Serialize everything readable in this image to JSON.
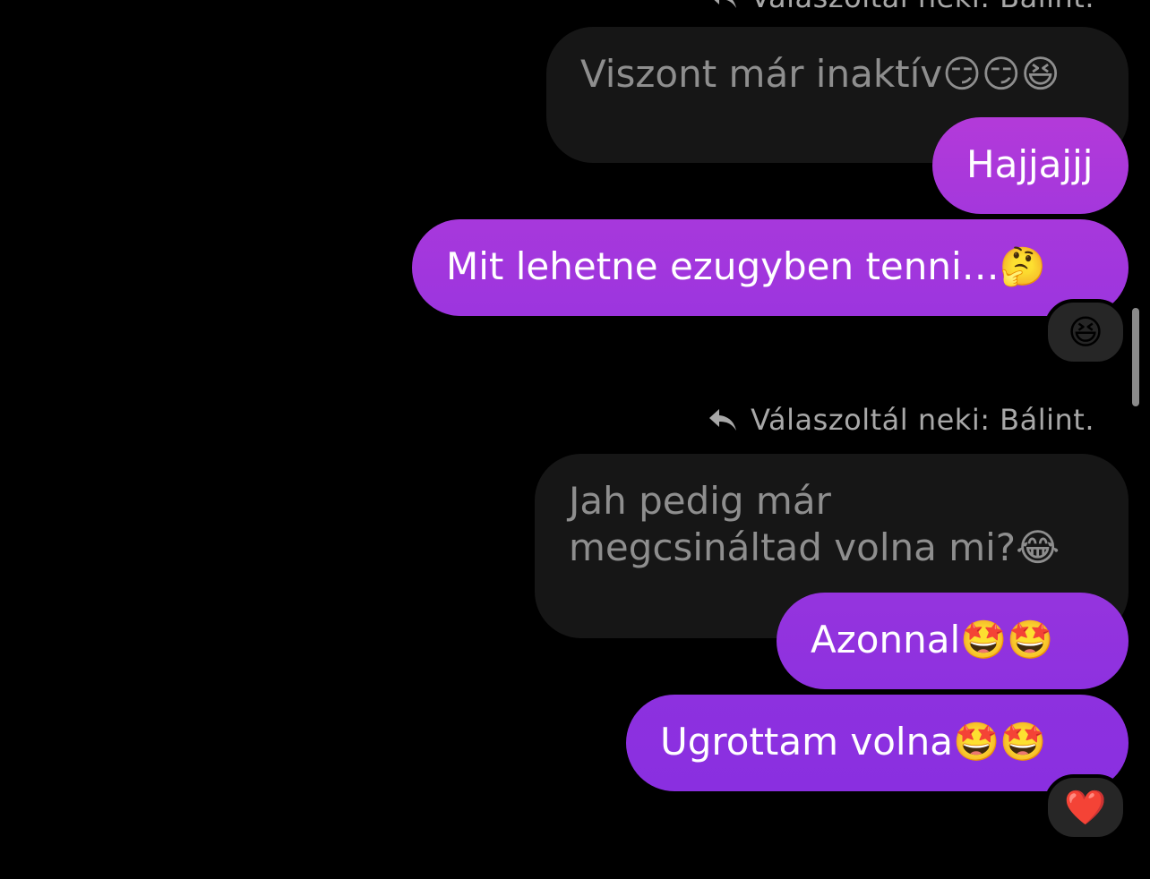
{
  "reply_hints": [
    {
      "text": "Válaszoltál neki: Bálint."
    },
    {
      "text": "Válaszoltál neki: Bálint."
    }
  ],
  "messages": {
    "quoted_1": "Viszont már inaktív😏😏😆",
    "sent_1": "Hajjajjj",
    "sent_2": "Mit lehetne ezugyben tenni…🤔",
    "reaction_1": "😆",
    "quoted_2": "Jah pedig már megcsináltad volna mi?😂",
    "sent_3": "Azonnal🤩🤩",
    "sent_4": "Ugrottam volna🤩🤩",
    "reaction_2": "❤️"
  },
  "colors": {
    "background": "#000000",
    "quoted_bubble": "#161616",
    "sent_gradient_top": "#b036d8",
    "sent_gradient_bottom": "#8a2fe0",
    "reply_hint_text": "#a8a8a8"
  },
  "icons": {
    "reply": "reply-arrow-icon"
  }
}
